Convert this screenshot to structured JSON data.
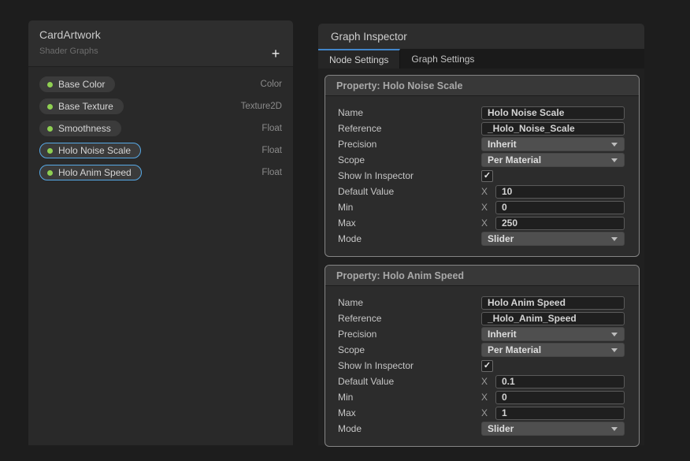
{
  "colors": {
    "selection_blue": "#57a9e6",
    "tab_accent_blue": "#4285c9",
    "property_dot_green": "#8fd052"
  },
  "blackboard": {
    "title": "CardArtwork",
    "subtitle": "Shader Graphs",
    "add_button_label": "+",
    "properties": [
      {
        "label": "Base Color",
        "type": "Color"
      },
      {
        "label": "Base Texture",
        "type": "Texture2D"
      },
      {
        "label": "Smoothness",
        "type": "Float"
      },
      {
        "label": "Holo Noise Scale",
        "type": "Float"
      },
      {
        "label": "Holo Anim Speed",
        "type": "Float"
      }
    ]
  },
  "inspector": {
    "title": "Graph Inspector",
    "tabs": [
      {
        "label": "Node Settings"
      },
      {
        "label": "Graph Settings"
      }
    ],
    "check_glyph": "✓",
    "panels": [
      {
        "header": "Property: Holo Noise Scale",
        "fields": {
          "name_label": "Name",
          "name_value": "Holo Noise Scale",
          "reference_label": "Reference",
          "reference_value": "_Holo_Noise_Scale",
          "precision_label": "Precision",
          "precision_value": "Inherit",
          "scope_label": "Scope",
          "scope_value": "Per Material",
          "show_label": "Show In Inspector",
          "default_label": "Default Value",
          "default_axis": "X",
          "default_value": "10",
          "min_label": "Min",
          "min_axis": "X",
          "min_value": "0",
          "max_label": "Max",
          "max_axis": "X",
          "max_value": "250",
          "mode_label": "Mode",
          "mode_value": "Slider"
        }
      },
      {
        "header": "Property: Holo Anim Speed",
        "fields": {
          "name_label": "Name",
          "name_value": "Holo Anim Speed",
          "reference_label": "Reference",
          "reference_value": "_Holo_Anim_Speed",
          "precision_label": "Precision",
          "precision_value": "Inherit",
          "scope_label": "Scope",
          "scope_value": "Per Material",
          "show_label": "Show In Inspector",
          "default_label": "Default Value",
          "default_axis": "X",
          "default_value": "0.1",
          "min_label": "Min",
          "min_axis": "X",
          "min_value": "0",
          "max_label": "Max",
          "max_axis": "X",
          "max_value": "1",
          "mode_label": "Mode",
          "mode_value": "Slider"
        }
      }
    ]
  }
}
